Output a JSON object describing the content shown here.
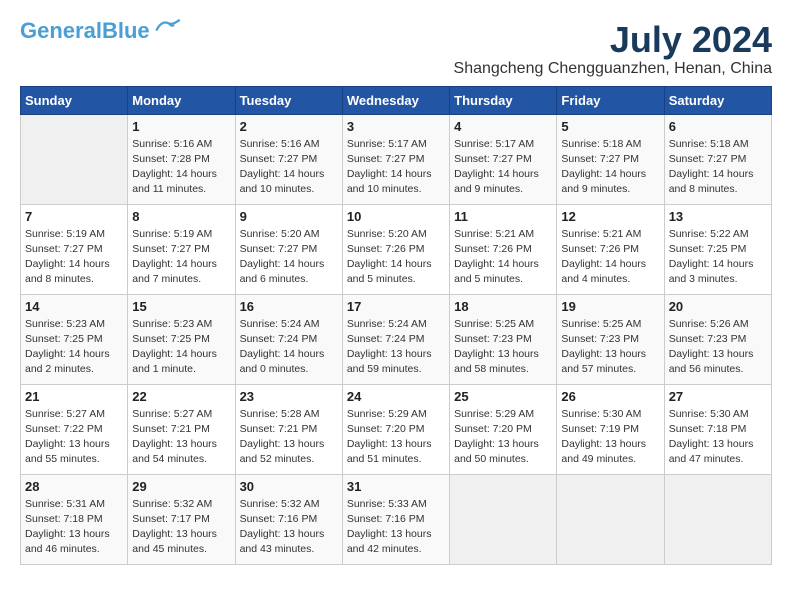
{
  "logo": {
    "line1": "General",
    "line2": "Blue"
  },
  "title": "July 2024",
  "location": "Shangcheng Chengguanzhen, Henan, China",
  "days_of_week": [
    "Sunday",
    "Monday",
    "Tuesday",
    "Wednesday",
    "Thursday",
    "Friday",
    "Saturday"
  ],
  "weeks": [
    [
      {
        "day": "",
        "info": ""
      },
      {
        "day": "1",
        "info": "Sunrise: 5:16 AM\nSunset: 7:28 PM\nDaylight: 14 hours\nand 11 minutes."
      },
      {
        "day": "2",
        "info": "Sunrise: 5:16 AM\nSunset: 7:27 PM\nDaylight: 14 hours\nand 10 minutes."
      },
      {
        "day": "3",
        "info": "Sunrise: 5:17 AM\nSunset: 7:27 PM\nDaylight: 14 hours\nand 10 minutes."
      },
      {
        "day": "4",
        "info": "Sunrise: 5:17 AM\nSunset: 7:27 PM\nDaylight: 14 hours\nand 9 minutes."
      },
      {
        "day": "5",
        "info": "Sunrise: 5:18 AM\nSunset: 7:27 PM\nDaylight: 14 hours\nand 9 minutes."
      },
      {
        "day": "6",
        "info": "Sunrise: 5:18 AM\nSunset: 7:27 PM\nDaylight: 14 hours\nand 8 minutes."
      }
    ],
    [
      {
        "day": "7",
        "info": "Sunrise: 5:19 AM\nSunset: 7:27 PM\nDaylight: 14 hours\nand 8 minutes."
      },
      {
        "day": "8",
        "info": "Sunrise: 5:19 AM\nSunset: 7:27 PM\nDaylight: 14 hours\nand 7 minutes."
      },
      {
        "day": "9",
        "info": "Sunrise: 5:20 AM\nSunset: 7:27 PM\nDaylight: 14 hours\nand 6 minutes."
      },
      {
        "day": "10",
        "info": "Sunrise: 5:20 AM\nSunset: 7:26 PM\nDaylight: 14 hours\nand 5 minutes."
      },
      {
        "day": "11",
        "info": "Sunrise: 5:21 AM\nSunset: 7:26 PM\nDaylight: 14 hours\nand 5 minutes."
      },
      {
        "day": "12",
        "info": "Sunrise: 5:21 AM\nSunset: 7:26 PM\nDaylight: 14 hours\nand 4 minutes."
      },
      {
        "day": "13",
        "info": "Sunrise: 5:22 AM\nSunset: 7:25 PM\nDaylight: 14 hours\nand 3 minutes."
      }
    ],
    [
      {
        "day": "14",
        "info": "Sunrise: 5:23 AM\nSunset: 7:25 PM\nDaylight: 14 hours\nand 2 minutes."
      },
      {
        "day": "15",
        "info": "Sunrise: 5:23 AM\nSunset: 7:25 PM\nDaylight: 14 hours\nand 1 minute."
      },
      {
        "day": "16",
        "info": "Sunrise: 5:24 AM\nSunset: 7:24 PM\nDaylight: 14 hours\nand 0 minutes."
      },
      {
        "day": "17",
        "info": "Sunrise: 5:24 AM\nSunset: 7:24 PM\nDaylight: 13 hours\nand 59 minutes."
      },
      {
        "day": "18",
        "info": "Sunrise: 5:25 AM\nSunset: 7:23 PM\nDaylight: 13 hours\nand 58 minutes."
      },
      {
        "day": "19",
        "info": "Sunrise: 5:25 AM\nSunset: 7:23 PM\nDaylight: 13 hours\nand 57 minutes."
      },
      {
        "day": "20",
        "info": "Sunrise: 5:26 AM\nSunset: 7:23 PM\nDaylight: 13 hours\nand 56 minutes."
      }
    ],
    [
      {
        "day": "21",
        "info": "Sunrise: 5:27 AM\nSunset: 7:22 PM\nDaylight: 13 hours\nand 55 minutes."
      },
      {
        "day": "22",
        "info": "Sunrise: 5:27 AM\nSunset: 7:21 PM\nDaylight: 13 hours\nand 54 minutes."
      },
      {
        "day": "23",
        "info": "Sunrise: 5:28 AM\nSunset: 7:21 PM\nDaylight: 13 hours\nand 52 minutes."
      },
      {
        "day": "24",
        "info": "Sunrise: 5:29 AM\nSunset: 7:20 PM\nDaylight: 13 hours\nand 51 minutes."
      },
      {
        "day": "25",
        "info": "Sunrise: 5:29 AM\nSunset: 7:20 PM\nDaylight: 13 hours\nand 50 minutes."
      },
      {
        "day": "26",
        "info": "Sunrise: 5:30 AM\nSunset: 7:19 PM\nDaylight: 13 hours\nand 49 minutes."
      },
      {
        "day": "27",
        "info": "Sunrise: 5:30 AM\nSunset: 7:18 PM\nDaylight: 13 hours\nand 47 minutes."
      }
    ],
    [
      {
        "day": "28",
        "info": "Sunrise: 5:31 AM\nSunset: 7:18 PM\nDaylight: 13 hours\nand 46 minutes."
      },
      {
        "day": "29",
        "info": "Sunrise: 5:32 AM\nSunset: 7:17 PM\nDaylight: 13 hours\nand 45 minutes."
      },
      {
        "day": "30",
        "info": "Sunrise: 5:32 AM\nSunset: 7:16 PM\nDaylight: 13 hours\nand 43 minutes."
      },
      {
        "day": "31",
        "info": "Sunrise: 5:33 AM\nSunset: 7:16 PM\nDaylight: 13 hours\nand 42 minutes."
      },
      {
        "day": "",
        "info": ""
      },
      {
        "day": "",
        "info": ""
      },
      {
        "day": "",
        "info": ""
      }
    ]
  ]
}
